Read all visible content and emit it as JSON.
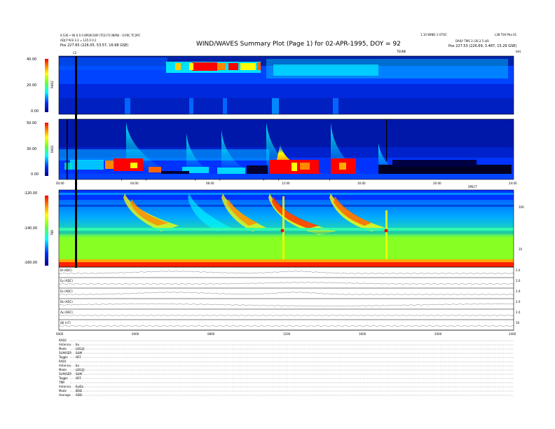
{
  "header": {
    "title": "WIND/WAVES Summary Plot (Page 1) for 02-APR-1995, DOY = 92",
    "top_left_line1": "9.530 • 90 0 0 0 8P00C00P (TCE FO ]NPN) - 0.P0C TC]/PC",
    "top_left_line2": "ADJ P N B 3.3 = 135 0 0 2",
    "top_left_pos": "Pos   227.65 (226.05, 53.57, 16.68 GSE)",
    "top_right_line1": "1.10 WIND 3 UTOC",
    "top_right_line2": "L38 T00 Pha 01",
    "top_right_line3": "DAILY TMS 3 (30,3 5 a0)",
    "top_right_pos": "Pos   227.53 (226.69, 3.487, 15.29 GSE)",
    "teline": "TEUNE",
    "mhz": "kHz",
    "c_marker": "C2"
  },
  "panels": {
    "rad2": {
      "label": "RAD2",
      "ticks": [
        "40.00",
        "20.00",
        "0.00"
      ],
      "right_ticks": []
    },
    "rad1": {
      "label": "RAD1",
      "ticks": [
        "50.00",
        "30.00",
        "0.00"
      ]
    },
    "tnr": {
      "label": "TNR",
      "ticks": [
        "-120.00",
        "-140.00",
        "-160.00"
      ],
      "right_ticks": [
        "100",
        "10"
      ]
    },
    "time_ticks_top": [
      "00:00",
      "04:00",
      "08:00",
      "12:00",
      "16:00",
      "20:00",
      "24:00"
    ],
    "time_ticks_bottom": [
      "0000",
      "0400",
      "0800",
      "1200",
      "1600",
      "2000",
      "2400"
    ],
    "axis_unit": "SPECT",
    "lines": [
      {
        "label": "Bl (ADC)",
        "r1": "2.0",
        "r2": "2.0"
      },
      {
        "label": "Ey (ADC)",
        "r1": "2.0",
        "r2": "2.0"
      },
      {
        "label": "Ez (ADC)",
        "r1": "2.0",
        "r2": "2.0"
      },
      {
        "label": "Bz (ADC)",
        "r1": "2.0",
        "r2": "2.0"
      },
      {
        "label": "Ay (ADC)",
        "r1": "2.0",
        "r2": "2.0"
      },
      {
        "label": "|B| (nT)",
        "r1": "10",
        "r2": "10"
      }
    ]
  },
  "info_block": [
    {
      "key": "RAD2",
      "val": ""
    },
    {
      "key": "Antenna",
      "val": "Ex"
    },
    {
      "key": "Mode",
      "val": "LOG(J)"
    },
    {
      "key": "SUM/SEP",
      "val": "SUM"
    },
    {
      "key": "Toggle",
      "val": "OFF"
    },
    {
      "key": "RAD1",
      "val": ""
    },
    {
      "key": "Antenna",
      "val": "Ex"
    },
    {
      "key": "Mode",
      "val": "LOG(J)"
    },
    {
      "key": "SUM/SEP",
      "val": "SUM"
    },
    {
      "key": "Toggle",
      "val": "OFF"
    },
    {
      "key": "TNR",
      "val": ""
    },
    {
      "key": "Antenna",
      "val": "Ey/Ez"
    },
    {
      "key": "Mode",
      "val": "BOD"
    },
    {
      "key": "Average",
      "val": "ADD"
    }
  ],
  "colors": {
    "background": "#0033ff",
    "navy": "#000088",
    "cyan": "#00ffff",
    "green": "#66ff33",
    "yellow": "#ffff00",
    "orange": "#ff8800",
    "red": "#ff0000"
  },
  "chart_data": {
    "type": "heatmap",
    "title": "WIND/WAVES Summary Plot (Page 1) for 02-APR-1995, DOY = 92",
    "x_range_hours": [
      0,
      24
    ],
    "type_iii_burst_onsets_hours": [
      3.3,
      4.6,
      7.2,
      8.5,
      10.8,
      11.6,
      14.3
    ],
    "rad2_emission_band_hours": [
      5.5,
      10.8
    ],
    "tnr_spikes_hours": [
      11.5,
      17.2
    ],
    "colorbar": [
      "#000088",
      "#0033ff",
      "#00ffff",
      "#66ff33",
      "#ffff00",
      "#ff8800",
      "#ff0000"
    ]
  }
}
